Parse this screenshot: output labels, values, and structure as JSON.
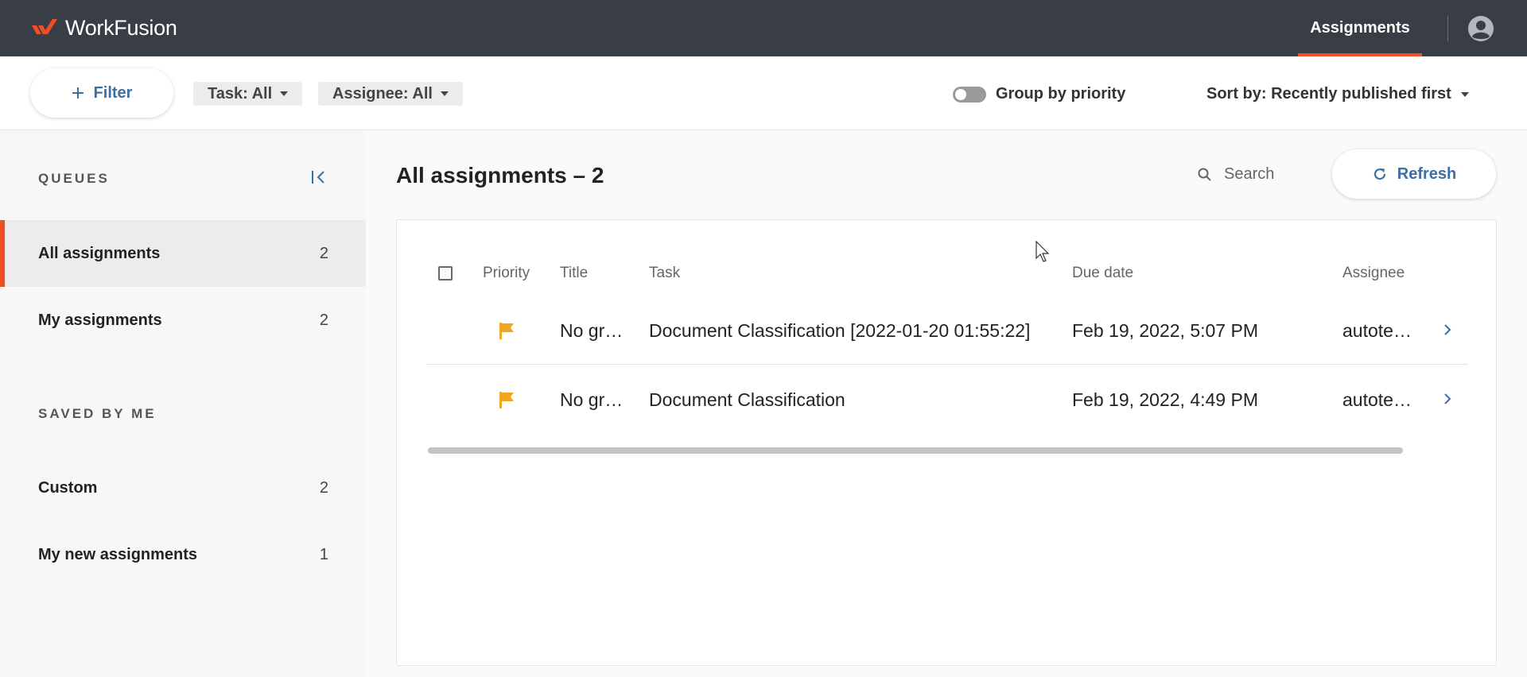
{
  "header": {
    "brand": "WorkFusion",
    "nav_tab": "Assignments"
  },
  "filters": {
    "filter_label": "Filter",
    "task_chip": "Task: All",
    "assignee_chip": "Assignee: All",
    "group_by_priority_label": "Group by priority",
    "group_by_priority_on": false,
    "sort_label": "Sort by: Recently published first"
  },
  "sidebar": {
    "queues_title": "QUEUES",
    "queues": [
      {
        "label": "All assignments",
        "count": "2",
        "active": true
      },
      {
        "label": "My assignments",
        "count": "2",
        "active": false
      }
    ],
    "saved_title": "SAVED BY ME",
    "saved": [
      {
        "label": "Custom",
        "count": "2"
      },
      {
        "label": "My new assignments",
        "count": "1"
      }
    ]
  },
  "main": {
    "title": "All assignments – 2",
    "search_placeholder": "Search",
    "refresh_label": "Refresh"
  },
  "table": {
    "columns": [
      "Priority",
      "Title",
      "Task",
      "Due date",
      "Assignee"
    ],
    "rows": [
      {
        "title": "No gr…",
        "task": "Document Classification [2022-01-20 01:55:22]",
        "due": "Feb 19, 2022, 5:07 PM",
        "assignee": "autote…"
      },
      {
        "title": "No gr…",
        "task": "Document Classification",
        "due": "Feb 19, 2022, 4:49 PM",
        "assignee": "autote…"
      }
    ]
  },
  "colors": {
    "topbar": "#393d45",
    "accent": "#f04e23",
    "link": "#3d6ea5",
    "flag": "#f0a81e"
  },
  "icons": [
    "workfusion-logo-icon",
    "account-circle-icon",
    "plus-icon",
    "caret-down-icon",
    "collapse-left-icon",
    "search-icon",
    "refresh-icon",
    "flag-icon",
    "chevron-right-icon",
    "mouse-cursor-icon"
  ]
}
